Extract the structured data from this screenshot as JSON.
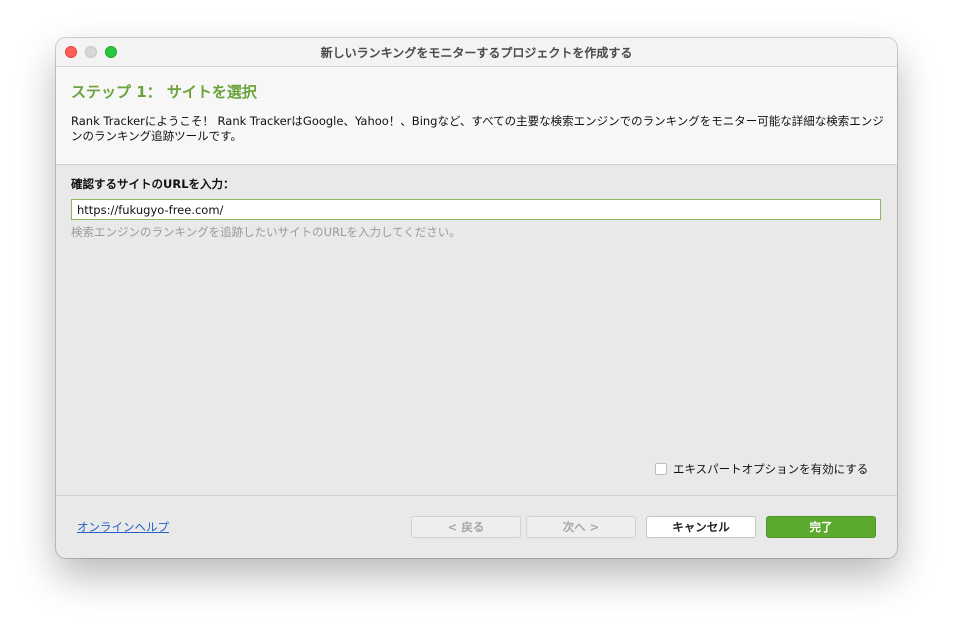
{
  "window": {
    "title": "新しいランキングをモニターするプロジェクトを作成する"
  },
  "header": {
    "step_title": "ステップ 1： サイトを選択",
    "description": "Rank Trackerにようこそ！ Rank TrackerはGoogle、Yahoo！、Bingなど、すべての主要な検索エンジンでのランキングをモニター可能な詳細な検索エンジンのランキング追跡ツールです。"
  },
  "form": {
    "url_label": "確認するサイトのURLを入力：",
    "url_value": "https://fukugyo-free.com/",
    "url_hint": "検索エンジンのランキングを追跡したいサイトのURLを入力してください。",
    "expert_option_label": "エキスパートオプションを有効にする",
    "expert_option_checked": false
  },
  "footer": {
    "help_link": "オンラインヘルプ",
    "back_label": "< 戻る",
    "next_label": "次へ >",
    "cancel_label": "キャンセル",
    "finish_label": "完了"
  },
  "colors": {
    "accent_green": "#6aa33a",
    "primary_button": "#5ba92e",
    "link_blue": "#2660c4"
  }
}
